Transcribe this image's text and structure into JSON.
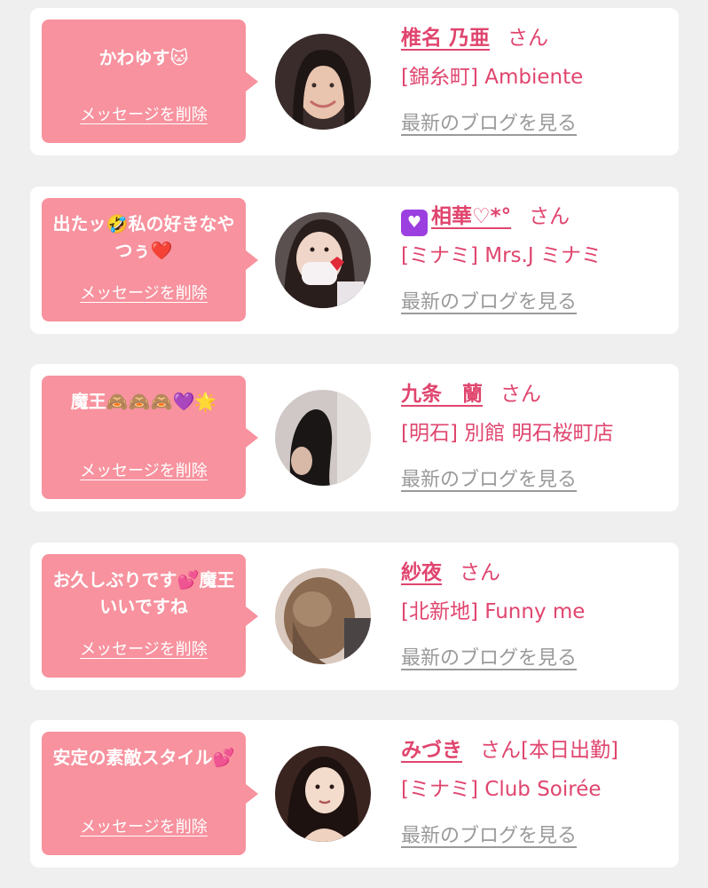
{
  "cards": [
    {
      "message": "かわゆす🐱",
      "delete_label": "メッセージを削除",
      "name": "椎名 乃亜",
      "honorific": "さん",
      "shop": "[錦糸町] Ambiente",
      "blog_label": "最新のブログを見る"
    },
    {
      "message": "出たッ🤣私の好きなやつぅ❤️",
      "delete_label": "メッセージを削除",
      "name": "相華♡*°",
      "name_prefix_icon": "purple-heart-box-icon",
      "honorific": "さん",
      "shop": "[ミナミ] Mrs.J ミナミ",
      "blog_label": "最新のブログを見る"
    },
    {
      "message": "魔王🙈🙈🙈💜🌟",
      "delete_label": "メッセージを削除",
      "name": "九条　蘭",
      "honorific": "さん",
      "shop": "[明石] 別館 明石桜町店",
      "blog_label": "最新のブログを見る"
    },
    {
      "message": "お久しぶりです💕魔王いいですね",
      "delete_label": "メッセージを削除",
      "name": "紗夜",
      "honorific": "さん",
      "shop": "[北新地] Funny me",
      "blog_label": "最新のブログを見る"
    },
    {
      "message": "安定の素敵スタイル💕",
      "delete_label": "メッセージを削除",
      "name": "みづき",
      "honorific": "さん[本日出勤]",
      "shop": "[ミナミ] Club Soirée",
      "blog_label": "最新のブログを見る"
    }
  ],
  "colors": {
    "background": "#efefef",
    "card": "#ffffff",
    "bubble": "#f7929e",
    "accent": "#e0456e",
    "muted_link": "#9a9a9a"
  }
}
